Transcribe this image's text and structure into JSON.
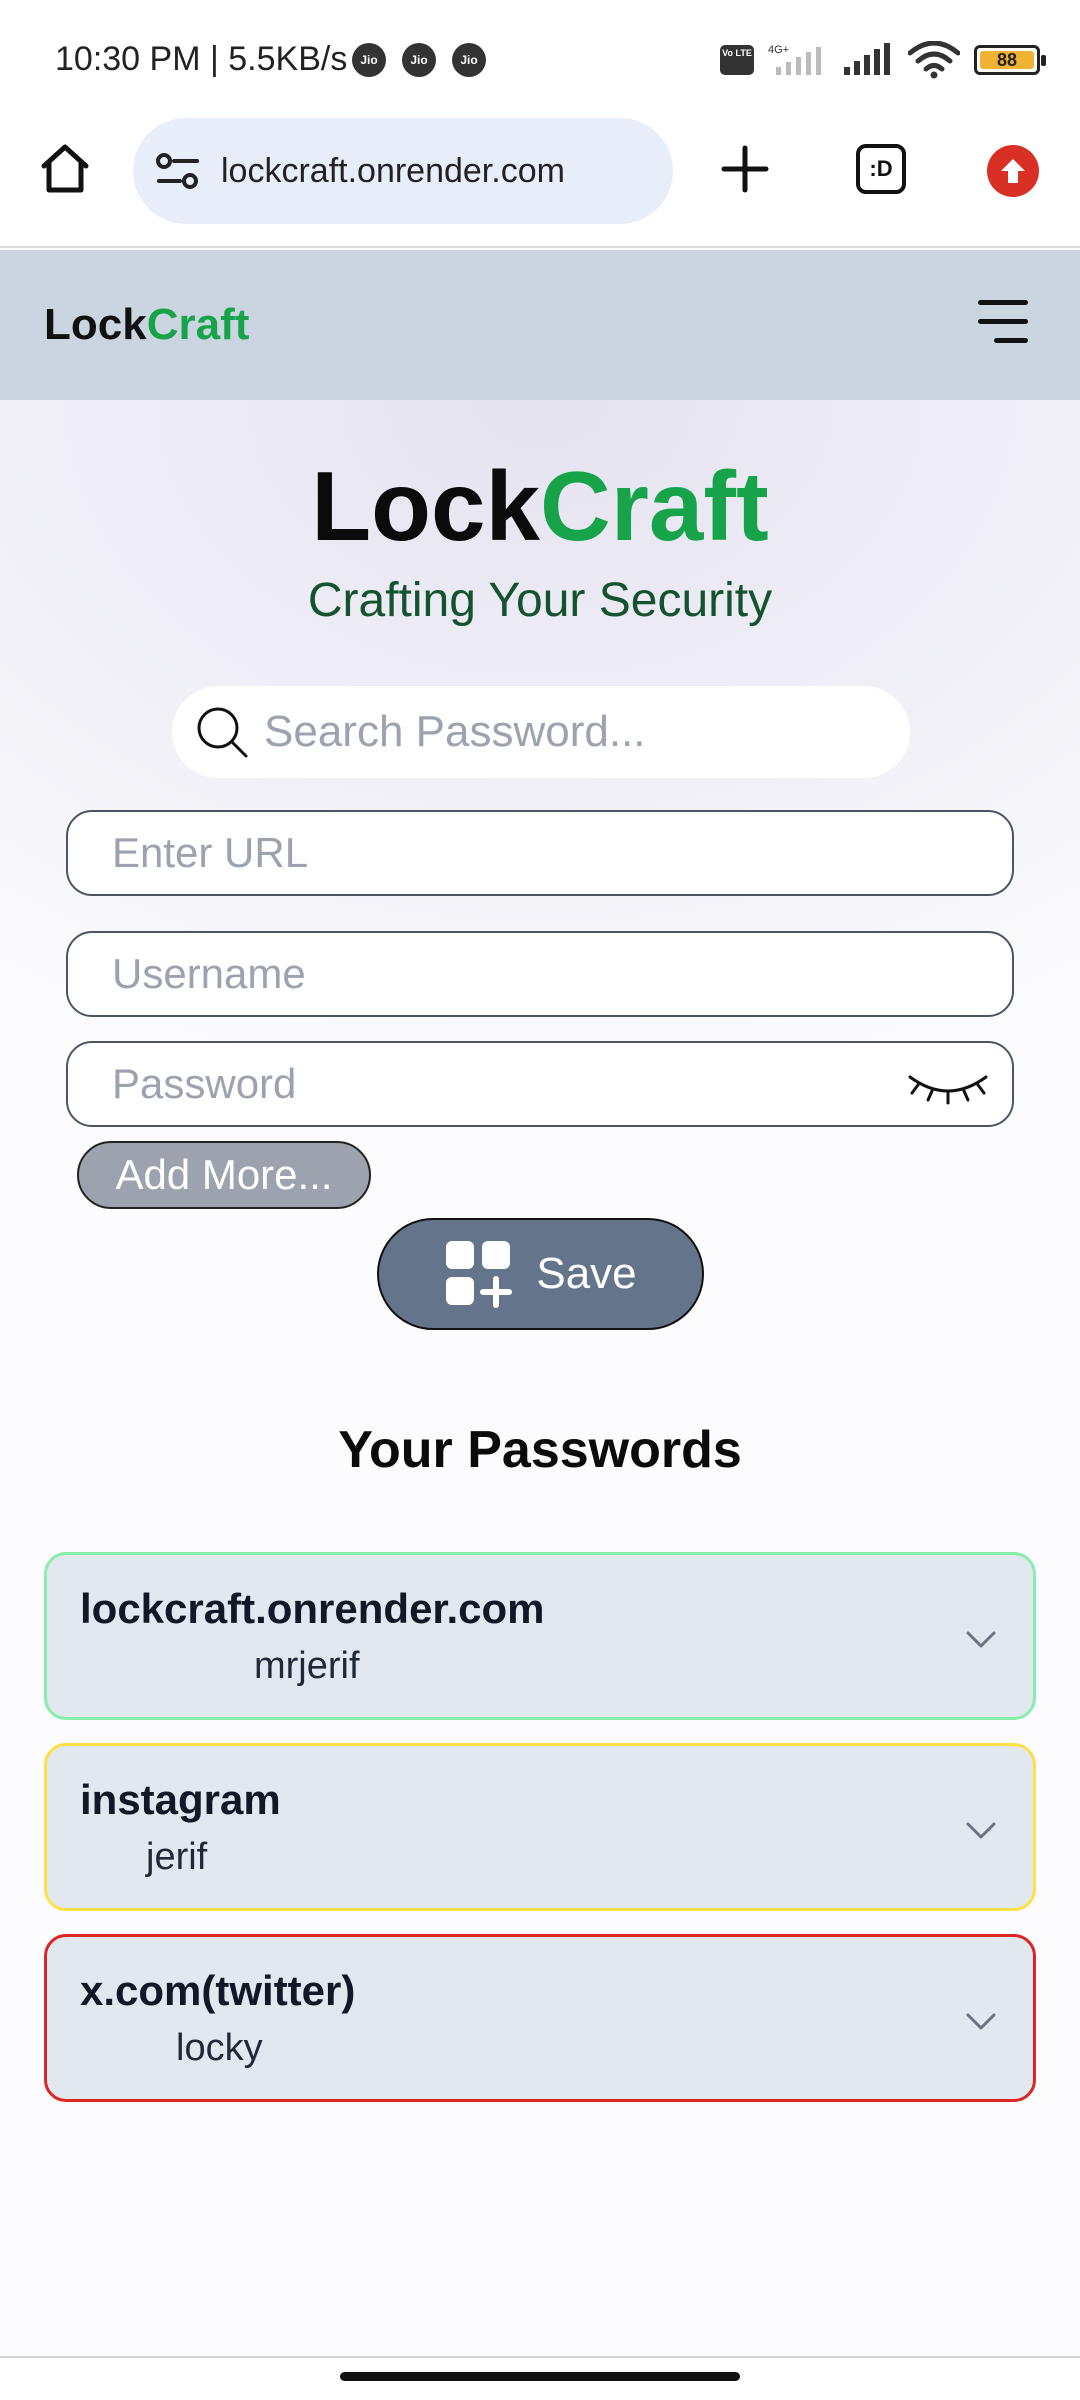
{
  "status_bar": {
    "time": "10:30 PM | 5.5KB/s",
    "carriers": [
      "Jio",
      "Jio",
      "Jio"
    ],
    "volte": "Vo LTE",
    "network": "4G+",
    "battery": "88"
  },
  "browser": {
    "url": "lockcraft.onrender.com",
    "tabs_label": ":D"
  },
  "nav": {
    "logo_part1": "Lock",
    "logo_part2": "Craft"
  },
  "hero": {
    "title_part1": "Lock",
    "title_part2": "Craft",
    "subtitle": "Crafting Your Security"
  },
  "form": {
    "search_placeholder": "Search Password...",
    "url_placeholder": "Enter URL",
    "username_placeholder": "Username",
    "password_placeholder": "Password",
    "add_more_label": "Add More...",
    "save_label": "Save"
  },
  "passwords": {
    "title": "Your Passwords",
    "items": [
      {
        "site": "lockcraft.onrender.com",
        "username": "mrjerif",
        "border_color": "#86efac"
      },
      {
        "site": "instagram",
        "username": "jerif",
        "border_color": "#fde047"
      },
      {
        "site": "x.com(twitter)",
        "username": "locky",
        "border_color": "#dc2626"
      }
    ]
  },
  "colors": {
    "accent_green": "#16a34a",
    "subtitle_green": "#14532d",
    "nav_bg": "#cbd5e1",
    "card_bg": "#e2e8f0",
    "save_bg": "#64748b"
  }
}
